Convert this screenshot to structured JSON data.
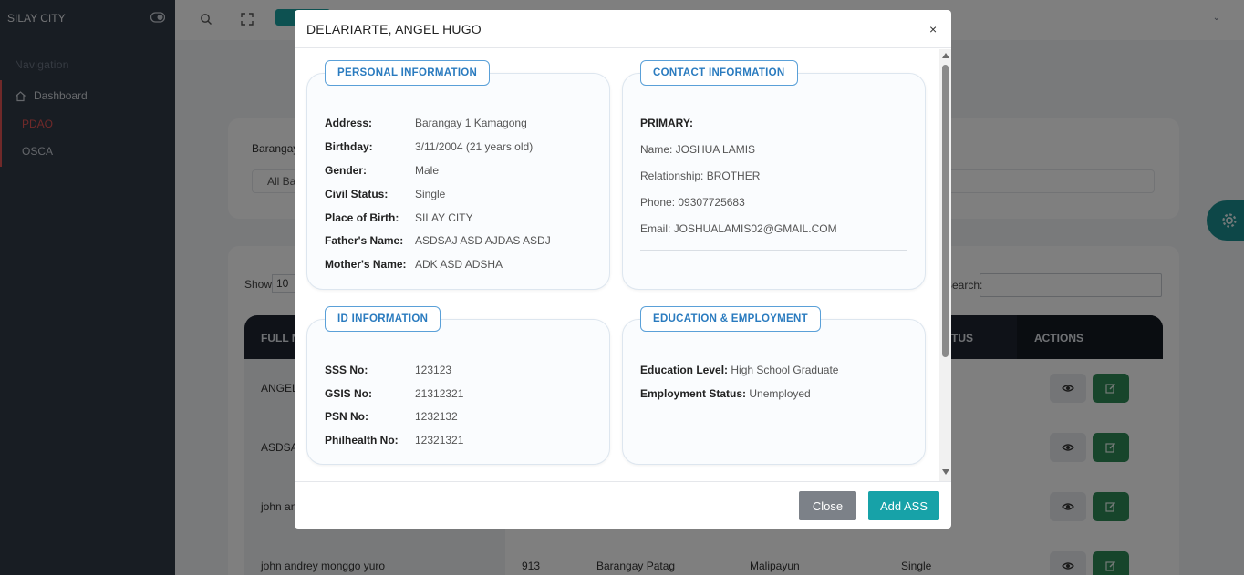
{
  "sidebar": {
    "brand": "SILAY CITY",
    "nav_heading": "Navigation",
    "items": [
      {
        "label": "Dashboard"
      },
      {
        "label": "PDAO"
      },
      {
        "label": "OSCA"
      }
    ]
  },
  "page": {
    "filter_label": "Barangay",
    "filter_value": "All Ba",
    "show_label": "Show",
    "show_value": "10",
    "search_label": "Search:",
    "table_headers": {
      "full_name": "FULL N",
      "status": "TUS",
      "actions": "ACTIONS"
    },
    "rows": [
      {
        "name": "ANGEL",
        "id": "",
        "barangay": "",
        "address": "",
        "status": ""
      },
      {
        "name": "ASDSA",
        "id": "",
        "barangay": "",
        "address": "",
        "status": ""
      },
      {
        "name": "john an",
        "id": "",
        "barangay": "",
        "address": "",
        "status": ""
      },
      {
        "name": "john andrey monggo yuro",
        "id": "913",
        "barangay": "Barangay Patag",
        "address": "Malipayun",
        "status": "Single"
      }
    ]
  },
  "modal": {
    "title": "DELARIARTE, ANGEL HUGO",
    "close_symbol": "×",
    "personal": {
      "heading": "PERSONAL INFORMATION",
      "fields": [
        {
          "label": "Address:",
          "value": "Barangay 1 Kamagong"
        },
        {
          "label": "Birthday:",
          "value": "3/11/2004 (21 years old)"
        },
        {
          "label": "Gender:",
          "value": "Male"
        },
        {
          "label": "Civil Status:",
          "value": "Single"
        },
        {
          "label": "Place of Birth:",
          "value": "SILAY CITY"
        },
        {
          "label": "Father's Name:",
          "value": "ASDSAJ ASD AJDAS ASDJ"
        },
        {
          "label": "Mother's Name:",
          "value": "ADK ASD ADSHA"
        }
      ]
    },
    "contact": {
      "heading": "CONTACT INFORMATION",
      "primary_label": "PRIMARY:",
      "lines": [
        "Name: JOSHUA LAMIS",
        "Relationship: BROTHER",
        "Phone: 09307725683",
        "Email: JOSHUALAMIS02@GMAIL.COM"
      ]
    },
    "id_info": {
      "heading": "ID INFORMATION",
      "fields": [
        {
          "label": "SSS No:",
          "value": "123123"
        },
        {
          "label": "GSIS No:",
          "value": "21312321"
        },
        {
          "label": "PSN No:",
          "value": "1232132"
        },
        {
          "label": "Philhealth No:",
          "value": "12321321"
        }
      ]
    },
    "education": {
      "heading": "EDUCATION & EMPLOYMENT",
      "fields": [
        {
          "label": "Education Level:",
          "value": "High School Graduate"
        },
        {
          "label": "Employment Status:",
          "value": "Unemployed"
        }
      ]
    },
    "footer": {
      "close_label": "Close",
      "add_label": "Add ASS"
    }
  },
  "colors": {
    "sidebar_bg": "#313a46",
    "accent_teal": "#17a2a8",
    "accent_red": "#e05252",
    "card_heading": "#2a7bbf",
    "edit_green": "#2e8b57"
  }
}
